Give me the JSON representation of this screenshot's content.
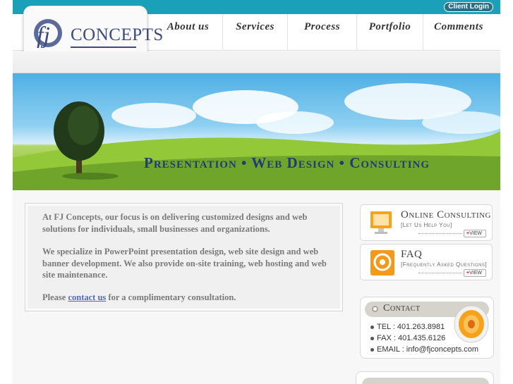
{
  "header": {
    "client_login": "Client Login",
    "logo_monogram": "fj",
    "logo_text": "CONCEPTS",
    "nav": [
      {
        "label": "About us"
      },
      {
        "label": "Services"
      },
      {
        "label": "Process"
      },
      {
        "label": "Portfolio"
      },
      {
        "label": "Comments"
      }
    ]
  },
  "banner": {
    "title": "Presentation • Web Design • Consulting"
  },
  "content": {
    "para1": "At FJ Concepts, our focus is on delivering customized designs and web solutions for individuals, small businesses and organizations.",
    "para2": "We specialize in PowerPoint presentation design, web site design and web banner development. We also provide on-site training, web hosting and web site maintenance.",
    "para3_before": "Please ",
    "para3_link": "contact us",
    "para3_after": " for a complimentary consultation."
  },
  "cards": {
    "online": {
      "title": "Online Consulting",
      "subtitle": "[Let Us Help You]",
      "view": "VIEW"
    },
    "faq": {
      "title": "FAQ",
      "subtitle": "[Frequently Asked Questions]",
      "view": "VIEW"
    }
  },
  "contact": {
    "title": "Contact",
    "tel": "TEL : 401.263.8981",
    "fax": "FAX : 401.435.6126",
    "email": "EMAIL : info@fjconcepts.com"
  },
  "colors": {
    "top_bar": "#1aa0b8",
    "logo_navy": "#3d4c7d",
    "banner_title": "#1f3d73",
    "link": "#4f6db0"
  }
}
